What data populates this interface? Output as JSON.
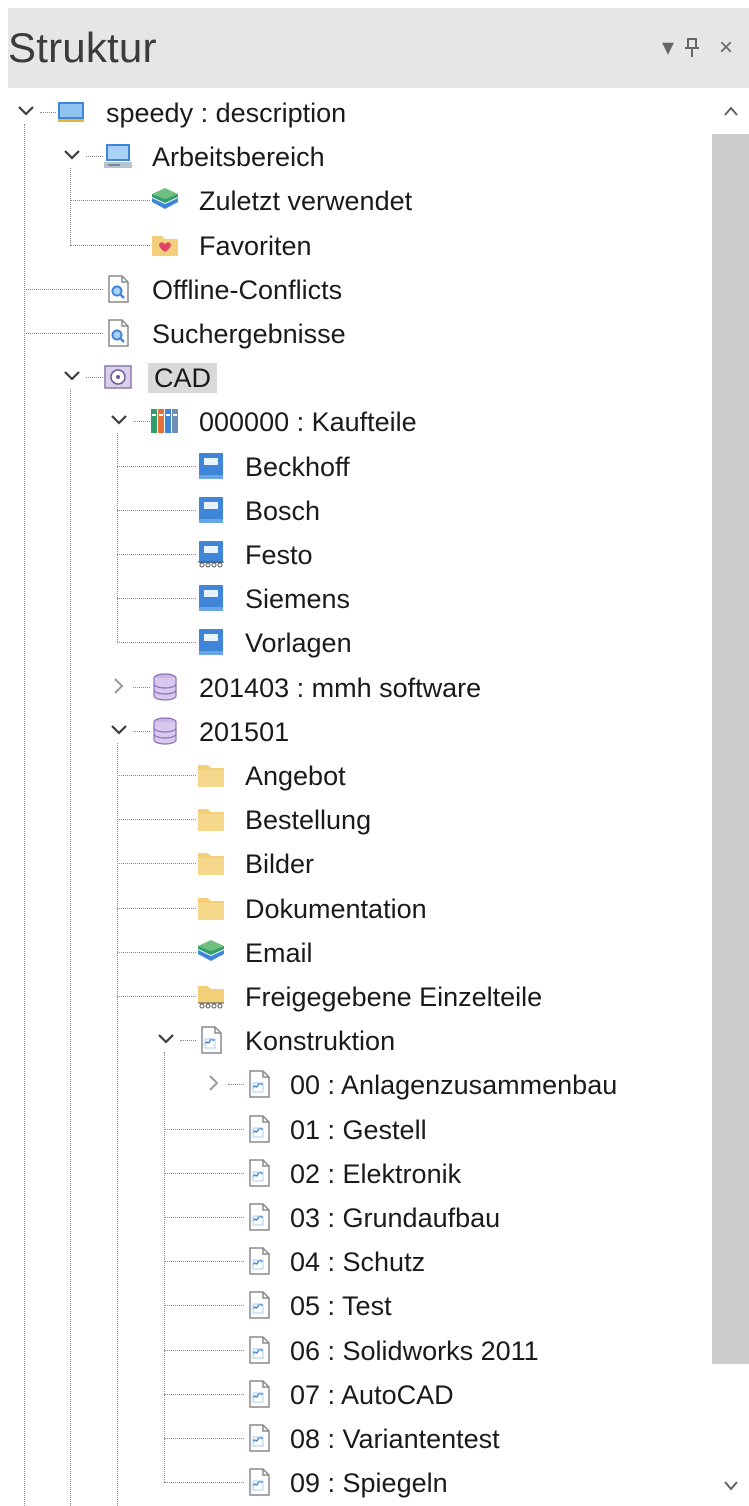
{
  "panel": {
    "title": "Struktur",
    "buttons": {
      "menu": "▾",
      "pin": "ᵖ",
      "close": "×"
    }
  },
  "colors": {
    "accent_blue": "#3f86d8",
    "folder": "#f3cf7a",
    "selection": "#d9d9d9"
  },
  "tree": [
    {
      "label": "speedy : description",
      "icon": "workspace-icon",
      "toggle": "expanded",
      "level": 0
    },
    {
      "label": "Arbeitsbereich",
      "icon": "monitor-icon",
      "toggle": "expanded",
      "level": 1
    },
    {
      "label": "Zuletzt verwendet",
      "icon": "layers-icon",
      "toggle": "none",
      "level": 2
    },
    {
      "label": "Favoriten",
      "icon": "heart-folder-icon",
      "toggle": "none",
      "level": 2
    },
    {
      "label": "Offline-Conflicts",
      "icon": "search-document-icon",
      "toggle": "none",
      "level": 1
    },
    {
      "label": "Suchergebnisse",
      "icon": "search-document-icon",
      "toggle": "none",
      "level": 1
    },
    {
      "label": "CAD",
      "icon": "disk-drive-icon",
      "toggle": "expanded",
      "level": 1,
      "selected": true
    },
    {
      "label": "000000 : Kaufteile",
      "icon": "books-icon",
      "toggle": "expanded",
      "level": 2
    },
    {
      "label": "Beckhoff",
      "icon": "catalog-book-icon",
      "toggle": "none",
      "level": 3
    },
    {
      "label": "Bosch",
      "icon": "catalog-book-icon",
      "toggle": "none",
      "level": 3
    },
    {
      "label": "Festo",
      "icon": "catalog-book-shared-icon",
      "toggle": "none",
      "level": 3
    },
    {
      "label": "Siemens",
      "icon": "catalog-book-icon",
      "toggle": "none",
      "level": 3
    },
    {
      "label": "Vorlagen",
      "icon": "catalog-book-icon",
      "toggle": "none",
      "level": 3
    },
    {
      "label": "201403 : mmh software",
      "icon": "database-icon",
      "toggle": "collapsed",
      "level": 2
    },
    {
      "label": "201501",
      "icon": "database-icon",
      "toggle": "expanded",
      "level": 2
    },
    {
      "label": "Angebot",
      "icon": "folder-icon",
      "toggle": "none",
      "level": 3
    },
    {
      "label": "Bestellung",
      "icon": "folder-icon",
      "toggle": "none",
      "level": 3
    },
    {
      "label": "Bilder",
      "icon": "folder-icon",
      "toggle": "none",
      "level": 3
    },
    {
      "label": "Dokumentation",
      "icon": "folder-icon",
      "toggle": "none",
      "level": 3
    },
    {
      "label": "Email",
      "icon": "layers-icon",
      "toggle": "none",
      "level": 3
    },
    {
      "label": "Freigegebene Einzelteile",
      "icon": "shared-folder-icon",
      "toggle": "none",
      "level": 3
    },
    {
      "label": "Konstruktion",
      "icon": "cad-document-icon",
      "toggle": "expanded",
      "level": 3
    },
    {
      "label": "00 : Anlagenzusammenbau",
      "icon": "cad-document-icon",
      "toggle": "collapsed",
      "level": 4
    },
    {
      "label": "01 : Gestell",
      "icon": "cad-document-icon",
      "toggle": "none",
      "level": 4
    },
    {
      "label": "02 : Elektronik",
      "icon": "cad-document-icon",
      "toggle": "none",
      "level": 4
    },
    {
      "label": "03 : Grundaufbau",
      "icon": "cad-document-icon",
      "toggle": "none",
      "level": 4
    },
    {
      "label": "04 : Schutz",
      "icon": "cad-document-icon",
      "toggle": "none",
      "level": 4
    },
    {
      "label": "05 : Test",
      "icon": "cad-document-icon",
      "toggle": "none",
      "level": 4
    },
    {
      "label": "06 : Solidworks 2011",
      "icon": "cad-document-icon",
      "toggle": "none",
      "level": 4
    },
    {
      "label": "07 : AutoCAD",
      "icon": "cad-document-icon",
      "toggle": "none",
      "level": 4
    },
    {
      "label": "08 : Variantentest",
      "icon": "cad-document-icon",
      "toggle": "none",
      "level": 4
    },
    {
      "label": "09 : Spiegeln",
      "icon": "cad-document-icon",
      "toggle": "none",
      "level": 4
    }
  ],
  "scrollbar": {
    "up": "^",
    "down": "⌄"
  }
}
